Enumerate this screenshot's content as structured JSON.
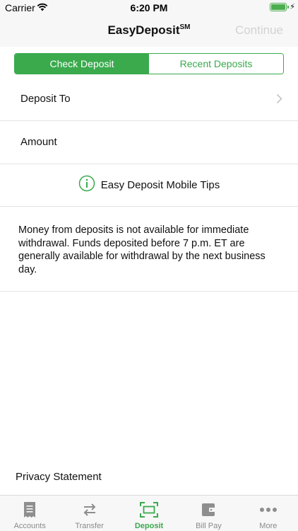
{
  "status_bar": {
    "carrier": "Carrier",
    "time": "6:20 PM",
    "battery_level": 1.0
  },
  "nav": {
    "title": "EasyDeposit",
    "title_mark": "SM",
    "continue_label": "Continue"
  },
  "segments": {
    "check_deposit": "Check Deposit",
    "recent_deposits": "Recent Deposits"
  },
  "form": {
    "deposit_to": "Deposit To",
    "amount": "Amount"
  },
  "tips": {
    "label": "Easy Deposit Mobile Tips",
    "icon": "info-icon"
  },
  "notice": "Money from deposits is not available for immediate withdrawal. Funds deposited before 7 p.m. ET are generally available for withdrawal by the next business day.",
  "privacy": "Privacy Statement",
  "tabs": [
    {
      "label": "Accounts",
      "icon": "receipt-icon"
    },
    {
      "label": "Transfer",
      "icon": "transfer-arrows-icon"
    },
    {
      "label": "Deposit",
      "icon": "scan-check-icon",
      "active": true
    },
    {
      "label": "Bill Pay",
      "icon": "wallet-icon"
    },
    {
      "label": "More",
      "icon": "more-dots-icon"
    }
  ],
  "colors": {
    "accent": "#3aaa4d",
    "inactive_tab": "#8a8a8a",
    "disabled_text": "#d3d3d3"
  }
}
